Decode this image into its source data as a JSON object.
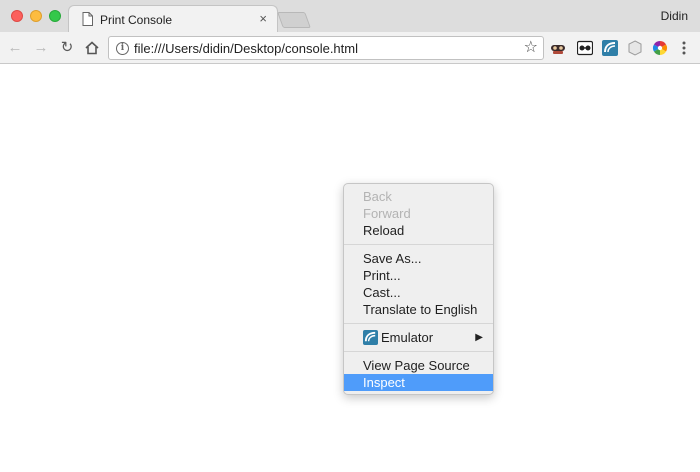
{
  "window": {
    "profile_name": "Didin"
  },
  "tab": {
    "title": "Print Console",
    "close_glyph": "×"
  },
  "toolbar": {
    "back_glyph": "←",
    "forward_glyph": "→",
    "reload_glyph": "↻",
    "url": "file:///Users/didin/Desktop/console.html",
    "star_glyph": "☆",
    "extensions": [
      "incognito-mask-icon",
      "glasses-extension-icon",
      "emulator-extension-icon",
      "shield-extension-icon",
      "color-wheel-extension-icon"
    ]
  },
  "context_menu": {
    "back": "Back",
    "forward": "Forward",
    "reload": "Reload",
    "save_as": "Save As...",
    "print": "Print...",
    "cast": "Cast...",
    "translate": "Translate to English",
    "emulator": "Emulator",
    "submenu_arrow": "▶",
    "view_source": "View Page Source",
    "inspect": "Inspect"
  },
  "colors": {
    "menu_highlight": "#4f9cfa",
    "traffic_close": "#fc605c",
    "traffic_minimize": "#fdbc40",
    "traffic_maximize": "#34c84a"
  }
}
